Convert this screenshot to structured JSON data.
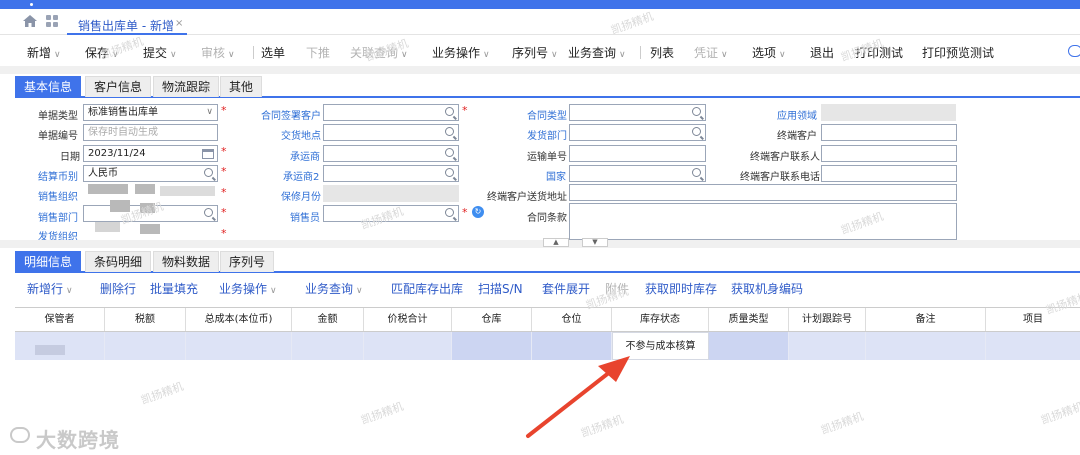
{
  "window": {
    "doc_tab_title": "销售出库单 - 新增",
    "close_glyph": "×"
  },
  "toolbar": [
    {
      "label": "新增",
      "caret": true,
      "disabled": false
    },
    {
      "label": "保存",
      "caret": true,
      "disabled": false
    },
    {
      "label": "提交",
      "caret": true,
      "disabled": false
    },
    {
      "label": "审核",
      "caret": true,
      "disabled": true
    },
    {
      "label": "选单",
      "caret": false,
      "disabled": false
    },
    {
      "label": "下推",
      "caret": false,
      "disabled": true
    },
    {
      "label": "关联查询",
      "caret": true,
      "disabled": true
    },
    {
      "label": "业务操作",
      "caret": true,
      "disabled": false
    },
    {
      "label": "序列号",
      "caret": true,
      "disabled": false
    },
    {
      "label": "业务查询",
      "caret": true,
      "disabled": false
    },
    {
      "label": "列表",
      "caret": false,
      "disabled": false
    },
    {
      "label": "凭证",
      "caret": true,
      "disabled": true
    },
    {
      "label": "选项",
      "caret": true,
      "disabled": false
    },
    {
      "label": "退出",
      "caret": false,
      "disabled": false
    },
    {
      "label": "打印测试",
      "caret": false,
      "disabled": false
    },
    {
      "label": "打印预览测试",
      "caret": false,
      "disabled": false
    }
  ],
  "header_tabs": [
    "基本信息",
    "客户信息",
    "物流跟踪",
    "其他"
  ],
  "form": {
    "col1": {
      "bill_type_label": "单据类型",
      "bill_type_value": "标准销售出库单",
      "bill_no_label": "单据编号",
      "bill_no_placeholder": "保存时自动生成",
      "date_label": "日期",
      "date_value": "2023/11/24",
      "currency_label": "结算币别",
      "currency_value": "人民币",
      "sale_org_label": "销售组织",
      "sale_dept_label": "销售部门",
      "ship_org_label": "发货组织"
    },
    "col2": {
      "contract_customer_label": "合同签署客户",
      "delivery_place_label": "交货地点",
      "carrier_label": "承运商",
      "carrier2_label": "承运商2",
      "warranty_label": "保修月份",
      "salesman_label": "销售员"
    },
    "col3": {
      "contract_type_label": "合同类型",
      "ship_dept_label": "发货部门",
      "waybill_label": "运输单号",
      "country_label": "国家",
      "end_address_label": "终端客户送货地址",
      "contract_terms_label": "合同条款"
    },
    "col4": {
      "field_label": "应用领域",
      "end_customer_label": "终端客户",
      "end_contact_label": "终端客户联系人",
      "end_phone_label": "终端客户联系电话"
    }
  },
  "detail_tabs": [
    "明细信息",
    "条码明细",
    "物料数据",
    "序列号"
  ],
  "detail_toolbar": [
    {
      "label": "新增行",
      "caret": true,
      "disabled": false
    },
    {
      "label": "删除行",
      "caret": false,
      "disabled": false
    },
    {
      "label": "批量填充",
      "caret": false,
      "disabled": false
    },
    {
      "label": "业务操作",
      "caret": true,
      "disabled": false
    },
    {
      "label": "业务查询",
      "caret": true,
      "disabled": false
    },
    {
      "label": "匹配库存出库",
      "caret": false,
      "disabled": false
    },
    {
      "label": "扫描S/N",
      "caret": false,
      "disabled": false
    },
    {
      "label": "套件展开",
      "caret": false,
      "disabled": false
    },
    {
      "label": "附件",
      "caret": false,
      "disabled": true
    },
    {
      "label": "获取即时库存",
      "caret": false,
      "disabled": false
    },
    {
      "label": "获取机身编码",
      "caret": false,
      "disabled": false
    }
  ],
  "grid": {
    "columns": [
      "保管者",
      "税额",
      "总成本(本位币)",
      "金额",
      "价税合计",
      "仓库",
      "仓位",
      "库存状态",
      "质量类型",
      "计划跟踪号",
      "备注",
      "项目"
    ],
    "row": [
      "",
      "",
      "",
      "",
      "",
      "",
      "",
      "不参与成本核算",
      "",
      "",
      "",
      ""
    ]
  },
  "watermark": "凯扬精机",
  "brand": "大数跨境",
  "colors": {
    "accent": "#3f73ea",
    "link": "#2f6fd6",
    "required": "#e02020",
    "arrow": "#e8442e"
  }
}
